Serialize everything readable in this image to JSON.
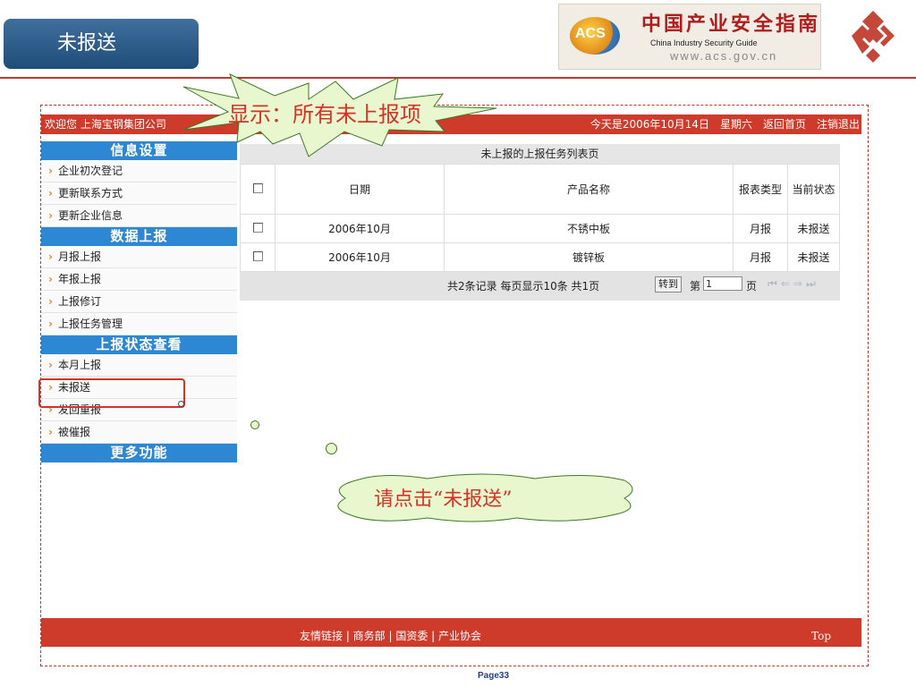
{
  "slide": {
    "title": "未报送",
    "page": "Page33"
  },
  "logo": {
    "acs": "ACS",
    "cn": "中国产业安全指南",
    "en": "China  Industry  Security  Guide",
    "url": "www.acs.gov.cn"
  },
  "topbar": {
    "welcome": "欢迎您  上海宝钢集团公司",
    "date": "今天是2006年10月14日",
    "weekday": "星期六",
    "home": "返回首页",
    "logout": "注销退出"
  },
  "sidebar": {
    "sections": [
      {
        "title": "信息设置",
        "items": [
          "企业初次登记",
          "更新联系方式",
          "更新企业信息"
        ]
      },
      {
        "title": "数据上报",
        "items": [
          "月报上报",
          "年报上报",
          "上报修订",
          "上报任务管理"
        ]
      },
      {
        "title": "上报状态查看",
        "items": [
          "本月上报",
          "未报送",
          "发回重报",
          "被催报"
        ]
      },
      {
        "title": "更多功能",
        "items": []
      }
    ]
  },
  "table": {
    "title": "未上报的上报任务列表页",
    "headers": {
      "date": "日期",
      "product": "产品名称",
      "type": "报表类型",
      "status": "当前状态"
    },
    "rows": [
      {
        "date": "2006年10月",
        "product": "不锈中板",
        "type": "月报",
        "status": "未报送"
      },
      {
        "date": "2006年10月",
        "product": "镀锌板",
        "type": "月报",
        "status": "未报送"
      }
    ]
  },
  "pager": {
    "summary": "共2条记录   每页显示10条   共1页",
    "goto": "转到",
    "page_prefix": "第",
    "page_value": "1",
    "page_suffix": "页"
  },
  "footer": {
    "links": "友情链接 | 商务部 | 国资委 | 产业协会",
    "top": "Top"
  },
  "annotations": {
    "burst": "显示：所有未上报项",
    "cloud": "请点击“未报送”"
  },
  "colors": {
    "accent_red": "#cf3b2a",
    "section_blue": "#2d87d2",
    "annotation_red": "#d63327",
    "callout_green": "#e9f7cf"
  }
}
